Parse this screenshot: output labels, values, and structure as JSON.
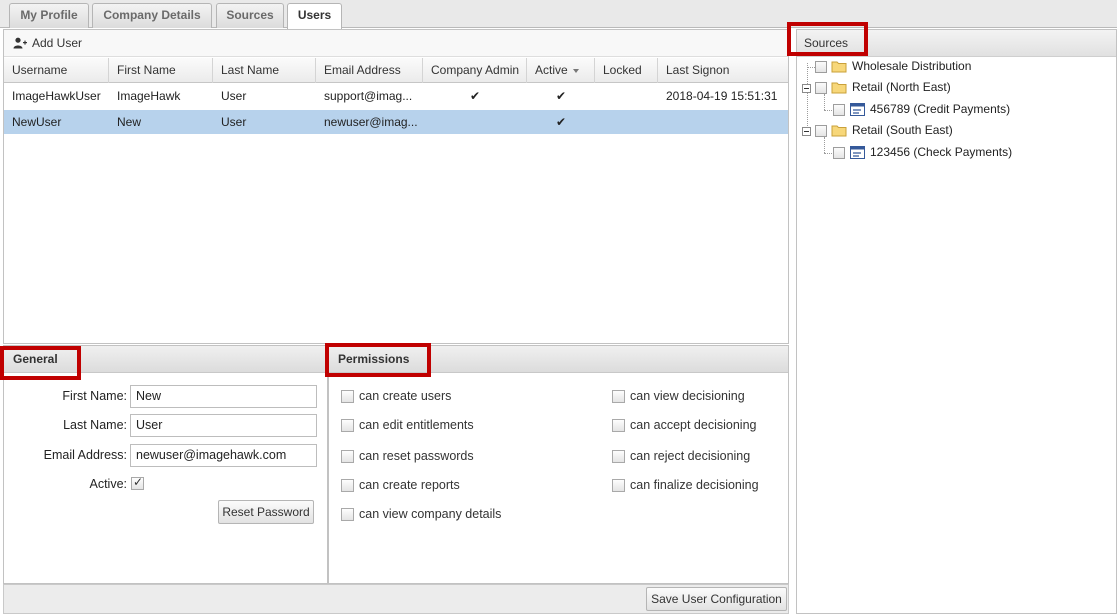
{
  "tabs": [
    {
      "label": "My Profile"
    },
    {
      "label": "Company Details"
    },
    {
      "label": "Sources"
    },
    {
      "label": "Users"
    }
  ],
  "toolbar": {
    "add_user_label": "Add User"
  },
  "grid": {
    "columns": [
      "Username",
      "First Name",
      "Last Name",
      "Email Address",
      "Company Admin",
      "Active",
      "Locked",
      "Last Signon"
    ],
    "rows": [
      {
        "username": "ImageHawkUser",
        "first_name": "ImageHawk",
        "last_name": "User",
        "email": "support@imag...",
        "company_admin": "✔",
        "active": "✔",
        "locked": "",
        "last_signon": "2018-04-19 15:51:31"
      },
      {
        "username": "NewUser",
        "first_name": "New",
        "last_name": "User",
        "email": "newuser@imag...",
        "company_admin": "",
        "active": "✔",
        "locked": "",
        "last_signon": ""
      }
    ]
  },
  "general": {
    "title": "General",
    "first_name_label": "First Name:",
    "first_name_value": "New",
    "last_name_label": "Last Name:",
    "last_name_value": "User",
    "email_label": "Email Address:",
    "email_value": "newuser@imagehawk.com",
    "active_label": "Active:",
    "active_checked": true,
    "reset_password_label": "Reset Password"
  },
  "permissions": {
    "title": "Permissions",
    "left": [
      "can create users",
      "can edit entitlements",
      "can reset passwords",
      "can create reports",
      "can view company details"
    ],
    "right": [
      "can view decisioning",
      "can accept decisioning",
      "can reject decisioning",
      "can finalize decisioning"
    ]
  },
  "save_button_label": "Save User Configuration",
  "sources": {
    "title": "Sources",
    "tree": [
      {
        "label": "Wholesale Distribution",
        "icon": "folder-icon"
      },
      {
        "label": "Retail (North East)",
        "icon": "folder-icon"
      },
      {
        "label": "456789 (Credit Payments)",
        "icon": "source-icon"
      },
      {
        "label": "Retail (South East)",
        "icon": "folder-icon"
      },
      {
        "label": "123456 (Check Payments)",
        "icon": "source-icon"
      }
    ]
  },
  "colors": {
    "highlight": "#c00000",
    "selected_row": "#b7d2ec"
  }
}
